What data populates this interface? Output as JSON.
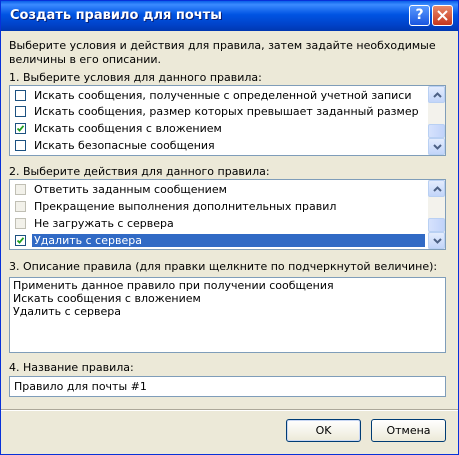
{
  "window": {
    "title": "Создать правило для почты",
    "help_label": "?"
  },
  "intro": "Выберите условия и действия для правила, затем задайте необходимые величины в его описании.",
  "conditions": {
    "label": "1. Выберите условия для данного правила:",
    "items": [
      {
        "label": "Искать сообщения, полученные с определенной учетной записи",
        "checked": false,
        "enabled": true
      },
      {
        "label": "Искать сообщения, размер которых превышает заданный размер",
        "checked": false,
        "enabled": true
      },
      {
        "label": "Искать сообщения с вложением",
        "checked": true,
        "enabled": true
      },
      {
        "label": "Искать безопасные сообщения",
        "checked": false,
        "enabled": true
      }
    ]
  },
  "actions": {
    "label": "2. Выберите действия для данного правила:",
    "items": [
      {
        "label": "Ответить заданным сообщением",
        "checked": false,
        "enabled": false
      },
      {
        "label": "Прекращение выполнения дополнительных правил",
        "checked": false,
        "enabled": false
      },
      {
        "label": "Не загружать с сервера",
        "checked": false,
        "enabled": false
      },
      {
        "label": "Удалить с сервера",
        "checked": true,
        "enabled": true,
        "selected": true
      }
    ]
  },
  "description": {
    "label": "3. Описание правила (для правки щелкните по подчеркнутой величине):",
    "lines": [
      "Применить данное правило при получении сообщения",
      "Искать сообщения с вложением",
      "Удалить с сервера"
    ]
  },
  "rule_name": {
    "label": "4. Название правила:",
    "value": "Правило для почты #1"
  },
  "buttons": {
    "ok": "OK",
    "cancel": "Отмена"
  },
  "colors": {
    "title_bar": "#0054e3",
    "selection": "#316ac5",
    "dialog_bg": "#ece9d8"
  }
}
